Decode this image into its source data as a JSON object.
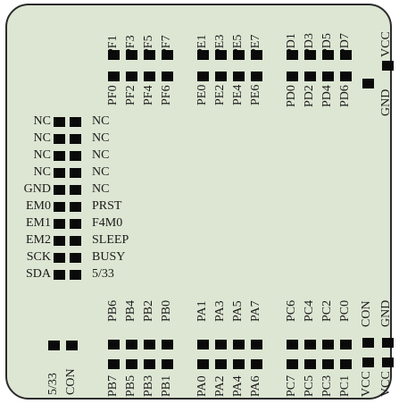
{
  "top_groups": [
    {
      "top": [
        "PF1",
        "PF3",
        "PF5",
        "PF7"
      ],
      "bottom": [
        "PF0",
        "PF2",
        "PF4",
        "PF6"
      ]
    },
    {
      "top": [
        "PE1",
        "PE3",
        "PE5",
        "PE7"
      ],
      "bottom": [
        "PE0",
        "PE2",
        "PE4",
        "PE6"
      ]
    },
    {
      "top": [
        "PD1",
        "PD3",
        "PD5",
        "PD7"
      ],
      "bottom": [
        "PD0",
        "PD2",
        "PD4",
        "PD6"
      ]
    }
  ],
  "top_right": {
    "outer": "VCC",
    "inner": "GND"
  },
  "left_rows": [
    {
      "left": "NC",
      "right": "NC"
    },
    {
      "left": "NC",
      "right": "NC"
    },
    {
      "left": "NC",
      "right": "NC"
    },
    {
      "left": "NC",
      "right": "NC"
    },
    {
      "left": "GND",
      "right": "NC"
    },
    {
      "left": "EM0",
      "right": "PRST"
    },
    {
      "left": "EM1",
      "right": "F4M0"
    },
    {
      "left": "EM2",
      "right": "SLEEP"
    },
    {
      "left": "SCK",
      "right": "BUSY"
    },
    {
      "left": "SDA",
      "right": "5/33"
    }
  ],
  "bottom_groups": [
    {
      "top": [
        "PB6",
        "PB4",
        "PB2",
        "PB0"
      ],
      "bottom": [
        "PB7",
        "PB5",
        "PB3",
        "PB1"
      ]
    },
    {
      "top": [
        "PA1",
        "PA3",
        "PA5",
        "PA7"
      ],
      "bottom": [
        "PA0",
        "PA2",
        "PA4",
        "PA6"
      ]
    },
    {
      "top": [
        "PC6",
        "PC4",
        "PC2",
        "PC0"
      ],
      "bottom": [
        "PC7",
        "PC5",
        "PC3",
        "PC1"
      ]
    }
  ],
  "bottom_left": {
    "left": "5/33",
    "right": "CON"
  },
  "bottom_right": {
    "top_left": "CON",
    "top_right": "GND",
    "bottom_left": "VCC",
    "bottom_right": "VCC"
  }
}
